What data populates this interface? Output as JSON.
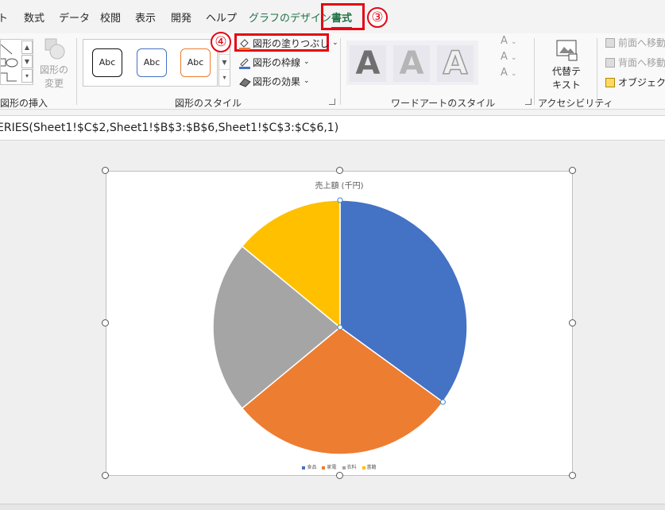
{
  "tabs": [
    {
      "label": "ト"
    },
    {
      "label": "数式"
    },
    {
      "label": "データ"
    },
    {
      "label": "校閲"
    },
    {
      "label": "表示"
    },
    {
      "label": "開発"
    },
    {
      "label": "ヘルプ"
    },
    {
      "label": "グラフのデザイン"
    },
    {
      "label": "書式"
    }
  ],
  "annotations": {
    "step3": "③",
    "step4": "④"
  },
  "ribbon": {
    "insert_shapes": {
      "change_shape_line1": "図形の",
      "change_shape_line2": "変更",
      "group_label": "図形の挿入"
    },
    "shape_styles": {
      "abc_items": [
        "Abc",
        "Abc",
        "Abc"
      ],
      "fill": "図形の塗りつぶし",
      "outline": "図形の枠線",
      "effects": "図形の効果",
      "group_label": "図形のスタイル"
    },
    "wordart": {
      "letters": [
        "A",
        "A",
        "A"
      ],
      "group_label": "ワードアートのスタイル"
    },
    "accessibility": {
      "alt_text_line1": "代替テ",
      "alt_text_line2": "キスト",
      "group_label": "アクセシビリティ"
    },
    "arrange": {
      "bring_forward": "前面へ移動",
      "send_backward": "背面へ移動",
      "selection_pane": "オブジェクトの"
    }
  },
  "formula_bar": {
    "text": "ERIES(Sheet1!$C$2,Sheet1!$B$3:$B$6,Sheet1!$C$3:$C$6,1)"
  },
  "chart_data": {
    "type": "pie",
    "title": "売上額 (千円)",
    "categories": [
      "食品",
      "家電",
      "衣料",
      "書籍"
    ],
    "values": [
      35,
      29,
      22,
      14
    ],
    "colors": [
      "#4472C4",
      "#ED7D31",
      "#A5A5A5",
      "#FFC000"
    ],
    "legend_position": "bottom",
    "selected_series": true
  },
  "colors": {
    "accent_green": "#207245",
    "highlight_red": "#e30613"
  }
}
